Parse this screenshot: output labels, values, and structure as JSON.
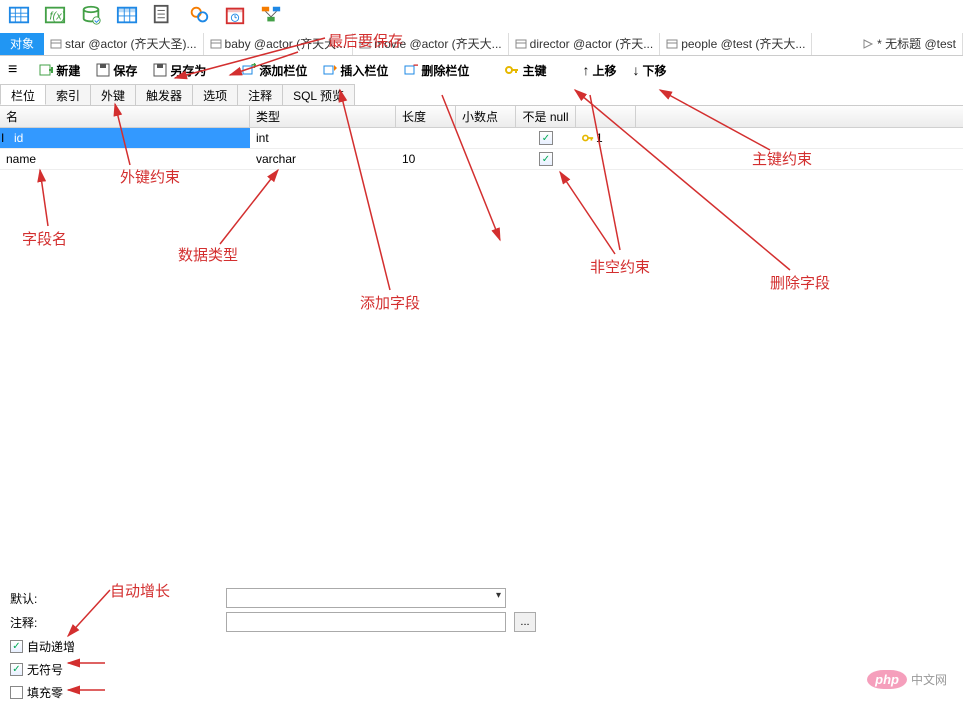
{
  "tabs": {
    "object": "对象",
    "t1": "star @actor (齐天大圣)...",
    "t2": "baby @actor (齐天大...",
    "t3": "movie @actor (齐天大...",
    "t4": "director @actor (齐天...",
    "t5": "people @test (齐天大...",
    "untitled": "* 无标题 @test"
  },
  "toolbar": {
    "new": "新建",
    "save": "保存",
    "saveas": "另存为",
    "addfield": "添加栏位",
    "insertfield": "插入栏位",
    "deletefield": "删除栏位",
    "primarykey": "主键",
    "moveup": "上移",
    "movedown": "下移"
  },
  "subtabs": {
    "field": "栏位",
    "index": "索引",
    "fk": "外键",
    "trigger": "触发器",
    "option": "选项",
    "comment": "注释",
    "sqlpreview": "SQL 预览"
  },
  "headers": {
    "name": "名",
    "type": "类型",
    "len": "长度",
    "dec": "小数点",
    "notnull": "不是 null"
  },
  "rows": [
    {
      "name": "id",
      "type": "int",
      "len": "",
      "dec": "",
      "notnull": true,
      "pk": "1",
      "selected": true
    },
    {
      "name": "name",
      "type": "varchar",
      "len": "10",
      "dec": "",
      "notnull": true,
      "pk": "",
      "selected": false
    }
  ],
  "bottom": {
    "default": "默认:",
    "comment": "注释:",
    "autoinc": "自动递增",
    "unsigned": "无符号",
    "zerofill": "填充零",
    "ellipsis": "..."
  },
  "annotations": {
    "save_last": "最后要保存",
    "fk": "外键约束",
    "pk": "主键约束",
    "fieldname": "字段名",
    "datatype": "数据类型",
    "addfield": "添加字段",
    "notnull": "非空约束",
    "delfield": "删除字段",
    "autoinc": "自动增长"
  },
  "logo": {
    "php": "php",
    "site": "中文网"
  }
}
